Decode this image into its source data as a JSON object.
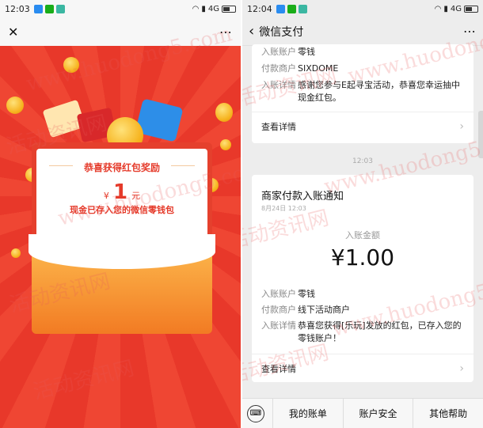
{
  "left": {
    "status": {
      "time": "12:03",
      "network": "4G"
    },
    "nav": {
      "close_glyph": "✕",
      "more_glyph": "⋯"
    },
    "card": {
      "title": "恭喜获得红包奖励",
      "currency": "¥",
      "amount": "1",
      "unit": "元",
      "subtitle": "现金已存入您的微信零钱包"
    }
  },
  "right": {
    "status": {
      "time": "12:04",
      "network": "4G"
    },
    "nav": {
      "back_glyph": "‹",
      "title": "微信支付",
      "more_glyph": "⋯"
    },
    "message1": {
      "rows": [
        {
          "key": "入账账户",
          "value": "零钱"
        },
        {
          "key": "付款商户",
          "value": "SIXDOME"
        },
        {
          "key": "入账详情",
          "value": "感谢您参与E起寻宝活动，恭喜您幸运抽中现金红包。"
        }
      ],
      "detail_link": "查看详情"
    },
    "time_label": "12:03",
    "message2": {
      "title": "商家付款入账通知",
      "date": "8月24日  12:03",
      "amount_label": "入账金额",
      "amount": "¥1.00",
      "rows": [
        {
          "key": "入账账户",
          "value": "零钱"
        },
        {
          "key": "付款商户",
          "value": "线下活动商户"
        },
        {
          "key": "入账详情",
          "value": "恭喜您获得[乐玩]发放的红包，已存入您的零钱账户！"
        }
      ],
      "detail_link": "查看详情"
    },
    "bottom_menu": [
      "我的账单",
      "账户安全",
      "其他帮助"
    ]
  },
  "watermark": {
    "url": "www.huodong5.com",
    "cn": "活动资讯网"
  },
  "colors": {
    "red_bg": "#f14a35",
    "red_text": "#e53a2a",
    "chat_bg": "#ededed"
  }
}
